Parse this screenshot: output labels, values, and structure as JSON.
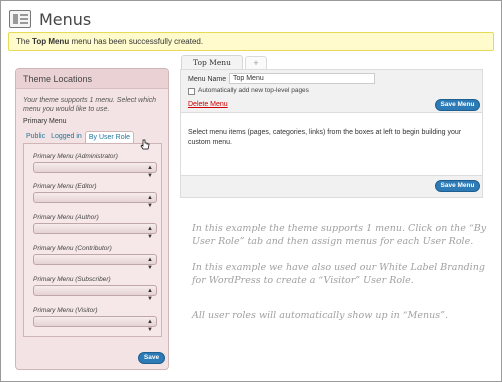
{
  "header": {
    "title": "Menus",
    "icon": "menus-icon"
  },
  "notice": {
    "prefix": "The",
    "menu_name": "Top Menu",
    "suffix": "menu has been successfully created."
  },
  "theme_locations": {
    "title": "Theme Locations",
    "description": "Your theme supports 1 menu. Select which menu you would like to use.",
    "primary_label": "Primary Menu",
    "tabs": [
      {
        "label": "Public",
        "active": false
      },
      {
        "label": "Logged in",
        "active": false
      },
      {
        "label": "By User Role",
        "active": true
      }
    ],
    "roles": [
      {
        "label": "Primary Menu (Administrator)",
        "value": ""
      },
      {
        "label": "Primary Menu (Editor)",
        "value": ""
      },
      {
        "label": "Primary Menu (Author)",
        "value": ""
      },
      {
        "label": "Primary Menu (Contributor)",
        "value": ""
      },
      {
        "label": "Primary Menu (Subscriber)",
        "value": ""
      },
      {
        "label": "Primary Menu (Visitor)",
        "value": ""
      }
    ],
    "save_label": "Save"
  },
  "menu_editor": {
    "tabs": [
      {
        "label": "Top Menu",
        "active": true
      },
      {
        "label": "+",
        "active": false
      }
    ],
    "menu_name_label": "Menu Name",
    "menu_name_value": "Top Menu",
    "auto_add_label": "Automatically add new top-level pages",
    "auto_add_checked": false,
    "delete_label": "Delete Menu",
    "save_label": "Save Menu",
    "instructions": "Select menu items (pages, categories, links) from the boxes at left to begin building your custom menu."
  },
  "annotation": {
    "line1": "In this example the theme supports 1 menu.  Click on the “By User Role” tab and then assign menus for each User Role.",
    "line2": "In this example we have also used our White Label Branding for WordPress to create a “Visitor” User Role.",
    "line3": "All user roles will automatically show up in “Menus”."
  },
  "colors": {
    "notice_bg": "#fffbcc",
    "sidebar_bg": "#f3e3e4",
    "button_blue": "#2d7bb6",
    "link_blue": "#21759b",
    "delete_red": "#cc0000",
    "annotation_gray": "#a0a0a0"
  }
}
